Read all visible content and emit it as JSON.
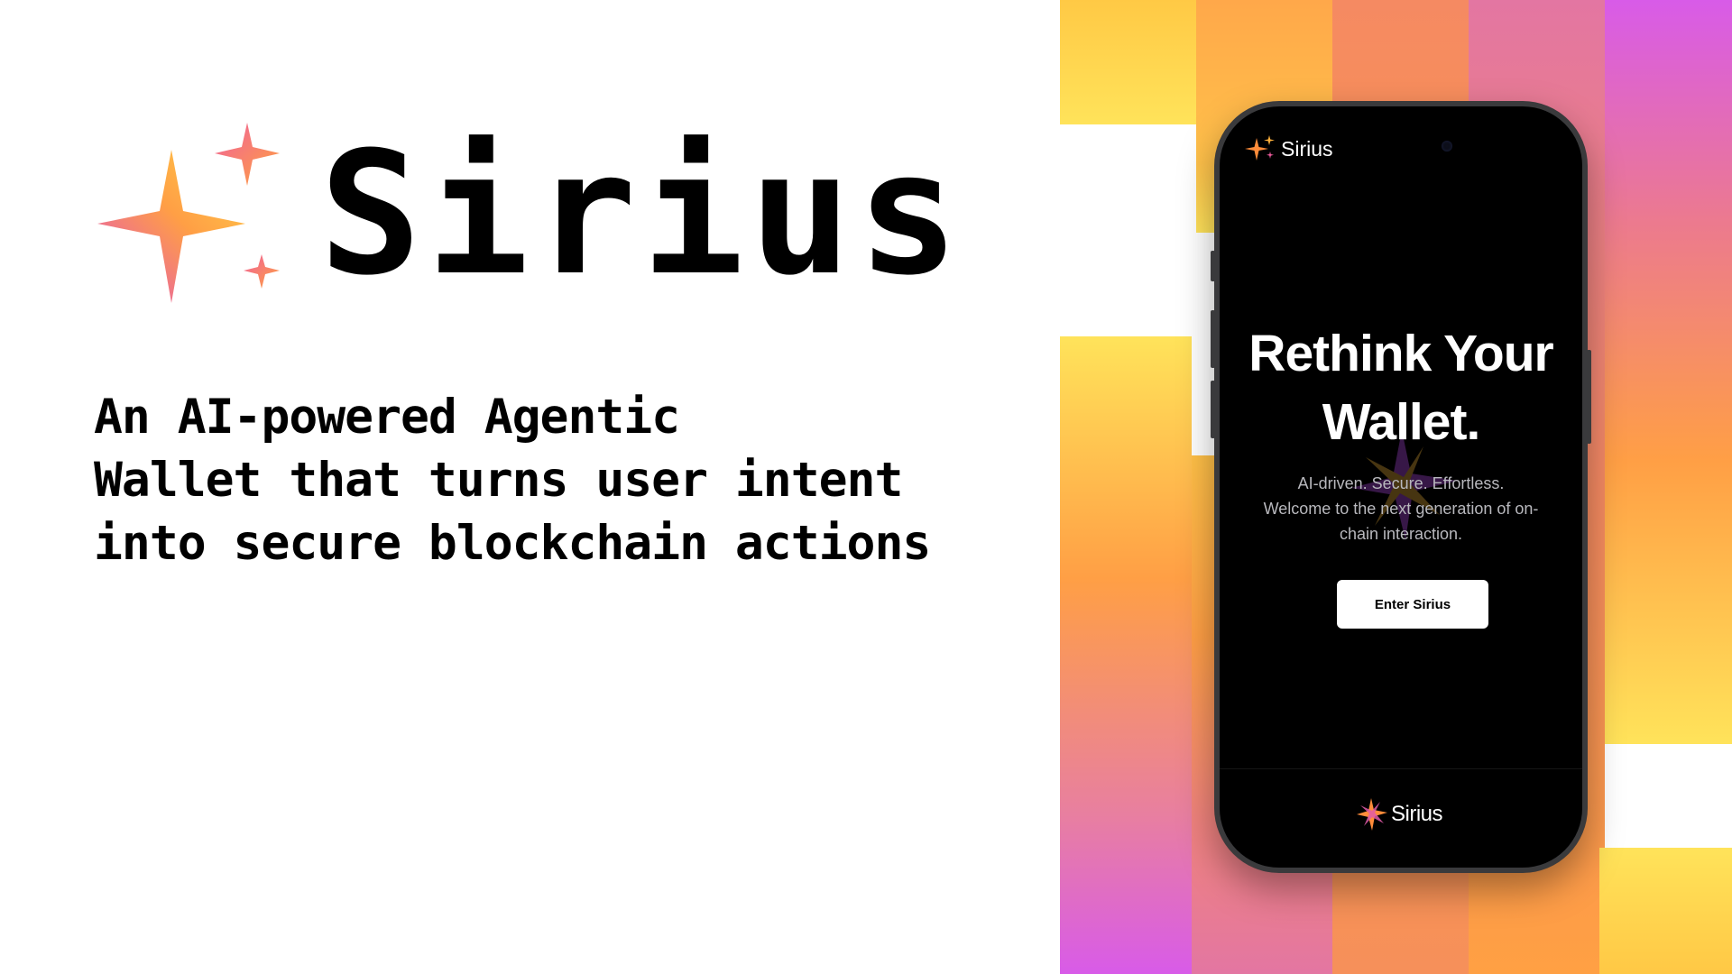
{
  "brand": {
    "name": "Sirius",
    "tagline_lines": [
      "An AI-powered Agentic",
      "Wallet that turns user intent",
      "into secure blockchain actions"
    ]
  },
  "phone": {
    "header": {
      "app_name": "Sirius",
      "logo_icon": "sparkle-icon"
    },
    "hero": {
      "title_lines": [
        "Rethink Your",
        "Wallet."
      ],
      "subtitle_lines": [
        "AI-driven. Secure. Effortless.",
        "Welcome to the next generation of on-",
        "chain interaction."
      ],
      "cta_label": "Enter Sirius"
    },
    "footer": {
      "brand_name": "Sirius",
      "logo_icon": "star-burst-icon"
    }
  },
  "colors": {
    "gradient_yellow": "#FFE35A",
    "gradient_orange": "#FF9F45",
    "gradient_coral": "#F58A62",
    "gradient_pink": "#E376A2",
    "gradient_magenta": "#D85BE8",
    "phone_screen": "#000000",
    "cta_background": "#FFFFFF"
  }
}
